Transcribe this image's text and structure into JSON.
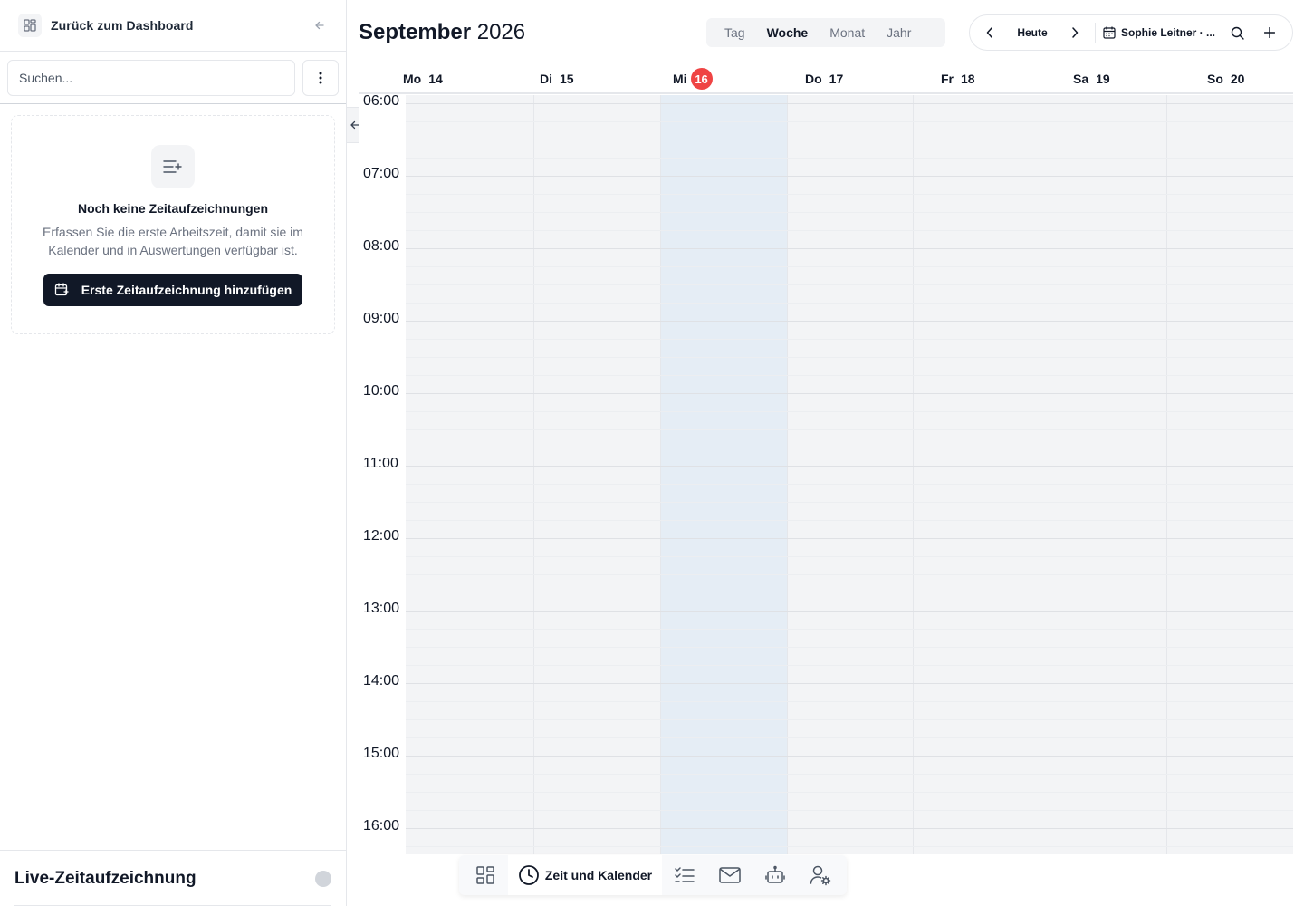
{
  "sidebar": {
    "back_label": "Zurück zum Dashboard",
    "search_placeholder": "Suchen...",
    "empty": {
      "title": "Noch keine Zeitaufzeichnungen",
      "description": "Erfassen Sie die erste Arbeitszeit, damit sie im Kalender und in Auswertungen verfügbar ist.",
      "button_label": "Erste Zeitaufzeichnung hinzufügen"
    },
    "live_title": "Live-Zeitaufzeichnung"
  },
  "header": {
    "month": "September",
    "year": "2026",
    "views": [
      "Tag",
      "Woche",
      "Monat",
      "Jahr"
    ],
    "active_view": "Woche",
    "today_label": "Heute",
    "calendar_label": "Sophie Leitner · ..."
  },
  "days": [
    {
      "name": "Mo",
      "num": "14"
    },
    {
      "name": "Di",
      "num": "15"
    },
    {
      "name": "Mi",
      "num": "16",
      "today": true
    },
    {
      "name": "Do",
      "num": "17"
    },
    {
      "name": "Fr",
      "num": "18"
    },
    {
      "name": "Sa",
      "num": "19"
    },
    {
      "name": "So",
      "num": "20"
    }
  ],
  "hours": [
    "06:00",
    "07:00",
    "08:00",
    "09:00",
    "10:00",
    "11:00",
    "12:00",
    "13:00",
    "14:00",
    "15:00",
    "16:00"
  ],
  "dock": {
    "active_label": "Zeit und Kalender",
    "items": [
      "dashboard-icon",
      "clock-icon",
      "checklist-icon",
      "mail-icon",
      "robot-icon",
      "user-settings-icon"
    ]
  },
  "colors": {
    "today_badge": "#ef4444",
    "today_column": "#e5edf5",
    "primary_button": "#111827"
  }
}
